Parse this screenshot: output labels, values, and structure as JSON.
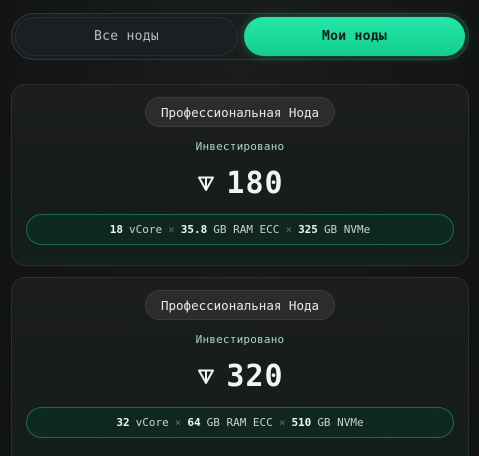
{
  "tabs": [
    {
      "label": "Все ноды",
      "active": false
    },
    {
      "label": "Мои ноды",
      "active": true
    }
  ],
  "nodes": [
    {
      "badge": "Профессиональная Нода",
      "invested_label": "Инвестировано",
      "currency_icon": "ton-icon",
      "amount": "180",
      "specs": {
        "cpu_value": "18",
        "cpu_unit": "vCore",
        "ram_value": "35.8",
        "ram_unit": "GB RAM ECC",
        "disk_value": "325",
        "disk_unit": "GB NVMe",
        "separator": "×"
      }
    },
    {
      "badge": "Профессиональная Нода",
      "invested_label": "Инвестировано",
      "currency_icon": "ton-icon",
      "amount": "320",
      "specs": {
        "cpu_value": "32",
        "cpu_unit": "vCore",
        "ram_value": "64",
        "ram_unit": "GB RAM ECC",
        "disk_value": "510",
        "disk_unit": "GB NVMe",
        "separator": "×"
      }
    }
  ],
  "colors": {
    "accent": "#1fdc9c",
    "background": "#141516",
    "card_border": "#2b2f31",
    "spec_border": "#1f6a4f"
  }
}
